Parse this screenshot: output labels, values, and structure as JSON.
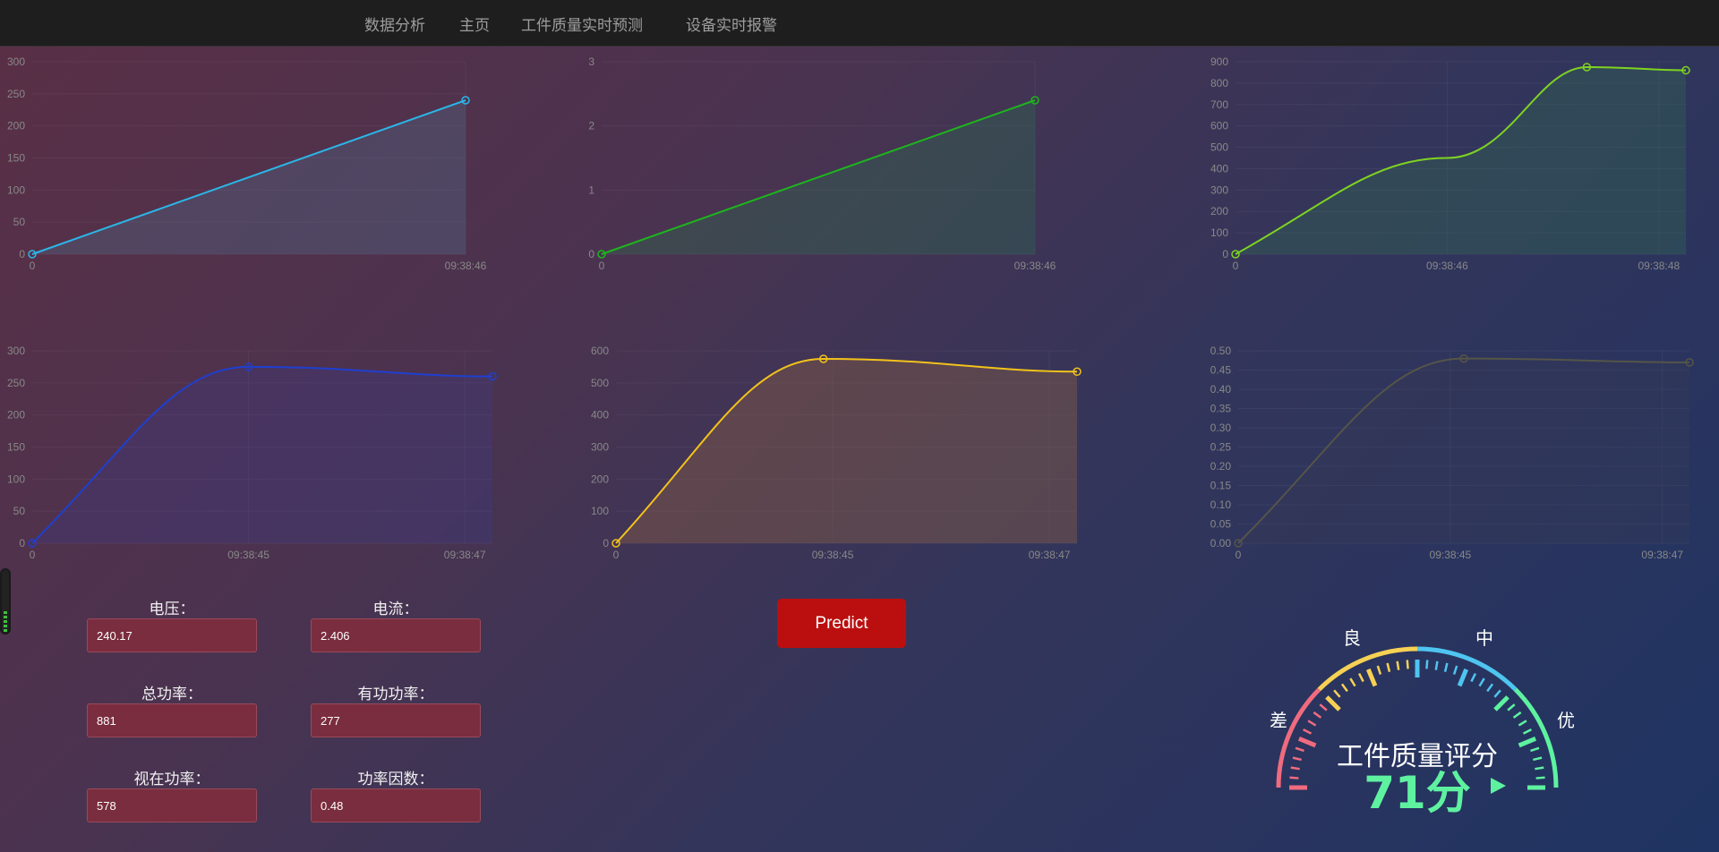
{
  "nav": {
    "items": [
      {
        "label": "数据分析"
      },
      {
        "label": "主页"
      },
      {
        "label": "工件质量实时预测"
      },
      {
        "label": "设备实时报警"
      }
    ]
  },
  "charts": [
    {
      "color": "#2bb6e8",
      "fill": "rgba(80,110,140,0.35)",
      "x_labels": [
        "0",
        "09:38:46"
      ],
      "y_ticks": [
        "0",
        "50",
        "100",
        "150",
        "200",
        "250",
        "300"
      ],
      "ymax": 300,
      "points": [
        0,
        240
      ]
    },
    {
      "color": "#1db51d",
      "fill": "rgba(40,120,80,0.30)",
      "x_labels": [
        "0",
        "09:38:46"
      ],
      "y_ticks": [
        "0",
        "1",
        "2",
        "3"
      ],
      "ymax": 3,
      "points": [
        0,
        2.4
      ]
    },
    {
      "color": "#7ed321",
      "fill": "rgba(50,110,80,0.35)",
      "x_labels": [
        "0",
        "09:38:46",
        "09:38:48"
      ],
      "y_ticks": [
        "0",
        "100",
        "200",
        "300",
        "400",
        "500",
        "600",
        "700",
        "800",
        "900"
      ],
      "ymax": 900,
      "points": [
        0,
        450,
        875,
        860
      ]
    },
    {
      "color": "#1f3fd0",
      "fill": "rgba(60,60,140,0.30)",
      "x_labels": [
        "0",
        "09:38:45",
        "09:38:47"
      ],
      "y_ticks": [
        "0",
        "50",
        "100",
        "150",
        "200",
        "250",
        "300"
      ],
      "ymax": 300,
      "points": [
        0,
        275,
        260
      ]
    },
    {
      "color": "#f2c21b",
      "fill": "rgba(130,90,70,0.45)",
      "x_labels": [
        "0",
        "09:38:45",
        "09:38:47"
      ],
      "y_ticks": [
        "0",
        "100",
        "200",
        "300",
        "400",
        "500",
        "600"
      ],
      "ymax": 600,
      "points": [
        0,
        575,
        535
      ]
    },
    {
      "color": "#555548",
      "fill": "rgba(60,60,80,0.25)",
      "x_labels": [
        "0",
        "09:38:45",
        "09:38:47"
      ],
      "y_ticks": [
        "0.00",
        "0.05",
        "0.10",
        "0.15",
        "0.20",
        "0.25",
        "0.30",
        "0.35",
        "0.40",
        "0.45",
        "0.50"
      ],
      "ymax": 0.5,
      "points": [
        0,
        0.48,
        0.47
      ]
    }
  ],
  "form": {
    "voltage": {
      "label": "电压：",
      "value": "240.17"
    },
    "current": {
      "label": "电流：",
      "value": "2.406"
    },
    "total_power": {
      "label": "总功率：",
      "value": "881"
    },
    "active_power": {
      "label": "有功功率：",
      "value": "277"
    },
    "apparent_power": {
      "label": "视在功率：",
      "value": "578"
    },
    "power_factor": {
      "label": "功率因数：",
      "value": "0.48"
    }
  },
  "predict_button": {
    "label": "Predict"
  },
  "gauge": {
    "title": "工件质量评分",
    "score_text": "71分",
    "score": 71,
    "labels": {
      "poor": "差",
      "good": "良",
      "medium": "中",
      "excellent": "优"
    },
    "colors": [
      "#f06b7f",
      "#f7d154",
      "#4fc4f0",
      "#5ef2a0"
    ]
  }
}
